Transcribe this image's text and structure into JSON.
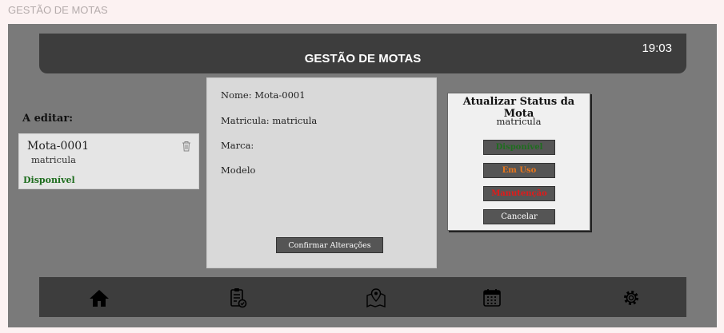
{
  "page_caption": "GESTÃO DE MOTAS",
  "header": {
    "title": "GESTÃO DE MOTAS",
    "clock": "19:03"
  },
  "editing": {
    "label": "A editar:",
    "item": {
      "name": "Mota-0001",
      "plate": "matricula",
      "status": "Disponível"
    }
  },
  "details": {
    "name_row": "Nome: Mota-0001",
    "plate_row": "Matricula: matricula",
    "brand_row": "Marca:",
    "model_row": "Modelo",
    "confirm_label": "Confirmar Alterações"
  },
  "status_panel": {
    "heading": "Atualizar Status da Mota",
    "plate": "matricula",
    "buttons": {
      "available": "Disponível",
      "in_use": "Em Uso",
      "maintenance": "Manutenção",
      "cancel": "Cancelar"
    }
  },
  "colors": {
    "available": "#1e6d1e",
    "in_use": "#e8761c",
    "maintenance": "#e21a1a",
    "bar": "#3d3d3d",
    "frame": "#7a7a7a"
  },
  "nav_icons": [
    "home-icon",
    "clipboard-check-icon",
    "map-pin-icon",
    "calendar-icon",
    "settings-gear-icon"
  ]
}
